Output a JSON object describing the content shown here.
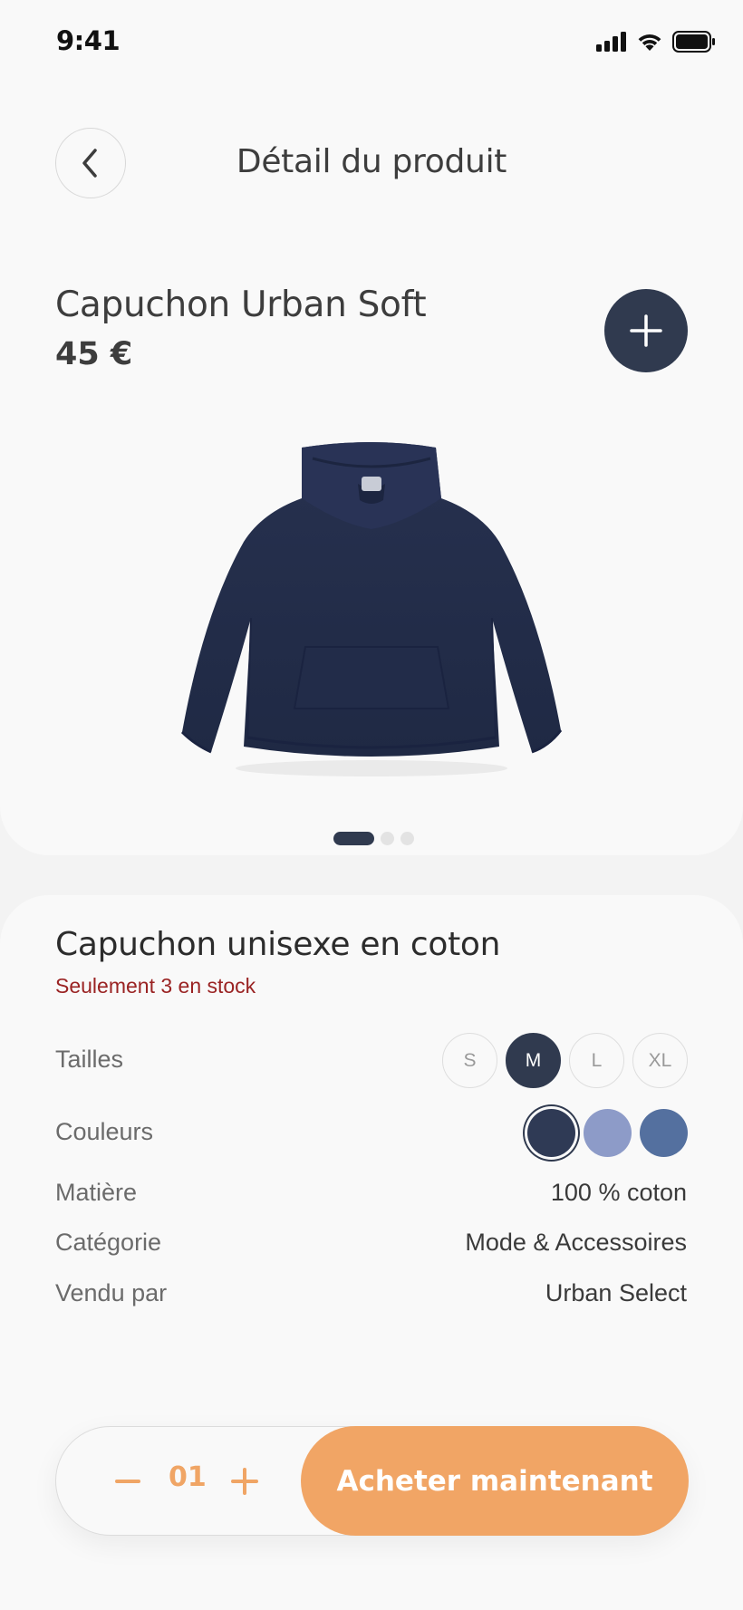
{
  "status_bar": {
    "time": "9:41"
  },
  "header": {
    "title": "Détail du produit"
  },
  "product": {
    "name": "Capuchon Urban Soft",
    "price": "45 €",
    "carousel": {
      "total": 3,
      "active": 1
    }
  },
  "details": {
    "title": "Capuchon unisexe en coton",
    "stock_note": "Seulement 3 en stock",
    "sizes_label": "Tailles",
    "sizes": [
      {
        "label": "S",
        "selected": false
      },
      {
        "label": "M",
        "selected": true
      },
      {
        "label": "L",
        "selected": false
      },
      {
        "label": "XL",
        "selected": false
      }
    ],
    "colors_label": "Couleurs",
    "colors": [
      {
        "hex": "#2f3a55",
        "selected": true
      },
      {
        "hex": "#8d9bc8",
        "selected": false
      },
      {
        "hex": "#54709f",
        "selected": false
      }
    ],
    "material_label": "Matière",
    "material_value": "100 % coton",
    "category_label": "Catégorie",
    "category_value": "Mode & Accessoires",
    "seller_label": "Vendu par",
    "seller_value": "Urban Select"
  },
  "purchase": {
    "quantity": "01",
    "buy_label": "Acheter maintenant"
  },
  "theme": {
    "primary": "#303a4f",
    "accent": "#f1a565",
    "warning": "#9a2323"
  }
}
